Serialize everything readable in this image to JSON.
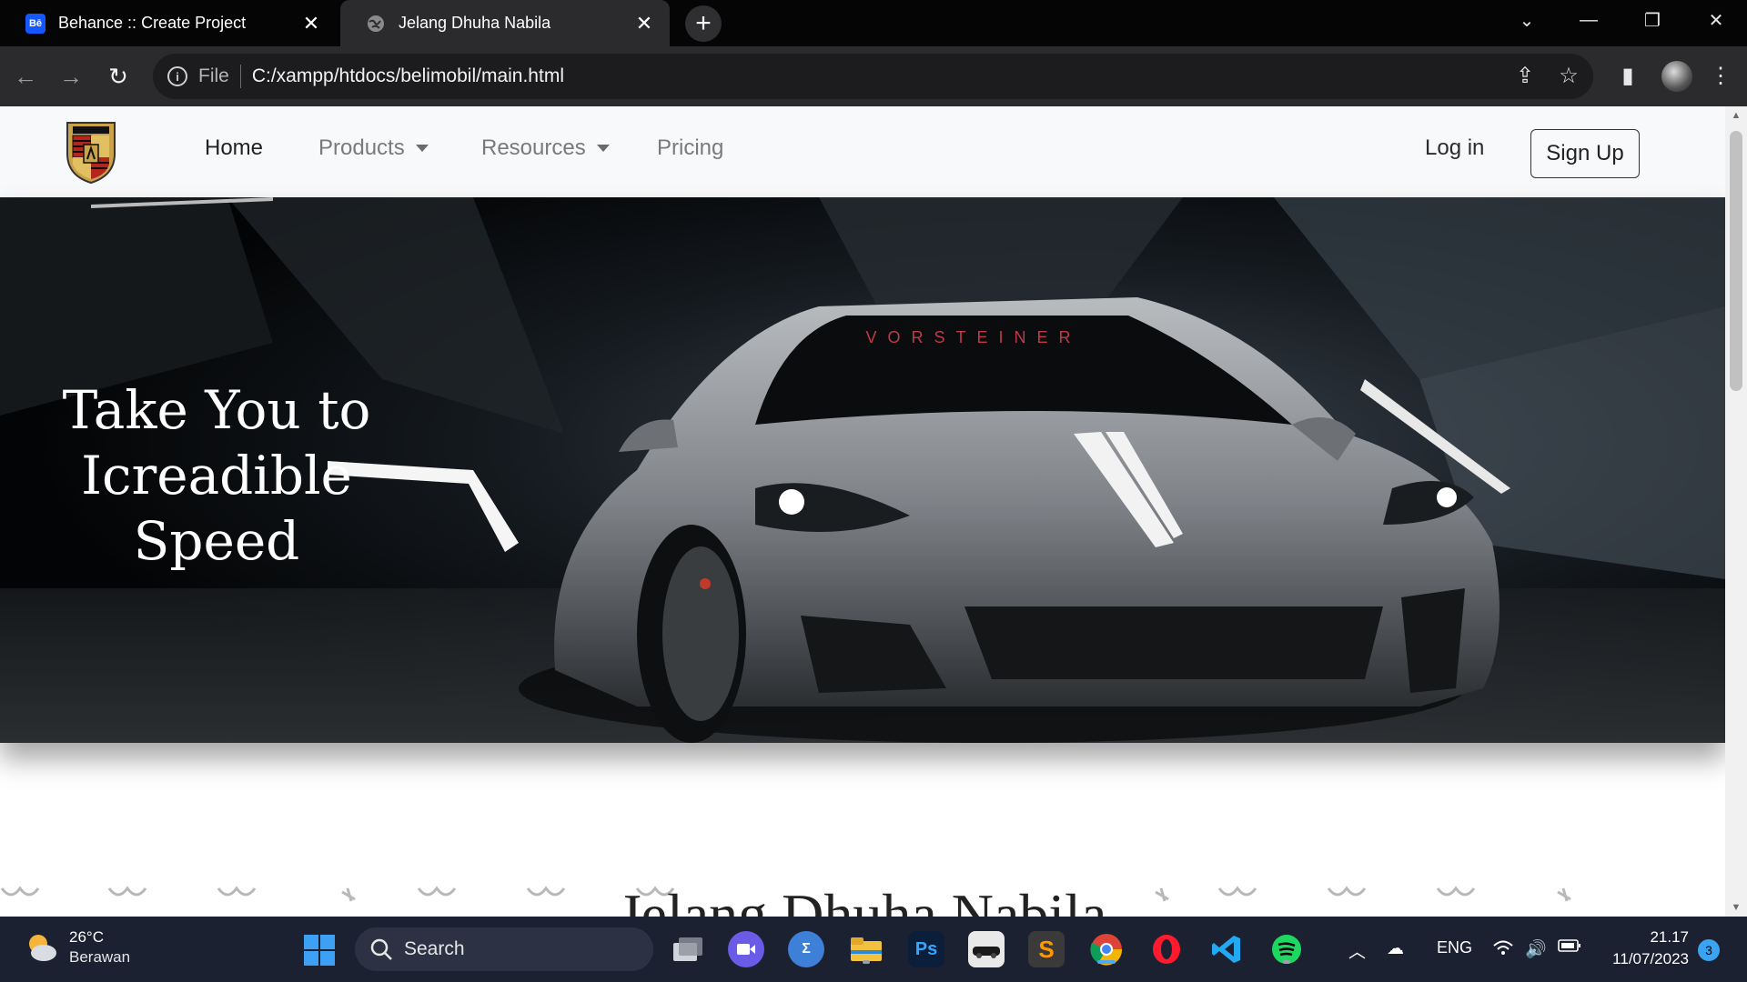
{
  "browser": {
    "tabs": [
      {
        "title": "Behance :: Create Project",
        "favicon": "Bē",
        "active": false
      },
      {
        "title": "Jelang Dhuha Nabila",
        "active": true
      }
    ],
    "address": {
      "scheme_label": "File",
      "url": "C:/xampp/htdocs/belimobil/main.html"
    }
  },
  "site": {
    "nav": {
      "home": "Home",
      "products": "Products",
      "resources": "Resources",
      "pricing": "Pricing",
      "login": "Log in",
      "signup": "Sign Up"
    },
    "hero": {
      "line1": "Take You to",
      "line2": "Icreadible Speed",
      "windshield_banner": "VORSTEINER"
    },
    "section_heading": "Jelang Dhuha Nabila"
  },
  "taskbar": {
    "weather": {
      "temp": "26°C",
      "condition": "Berawan"
    },
    "search_label": "Search",
    "language": "ENG",
    "time": "21.17",
    "date": "11/07/2023",
    "notification_count": "3"
  },
  "colors": {
    "tab_strip": "#050505",
    "toolbar": "#2b2b2d",
    "nav_bg": "#f8f9fa",
    "taskbar": "#1c2131"
  }
}
